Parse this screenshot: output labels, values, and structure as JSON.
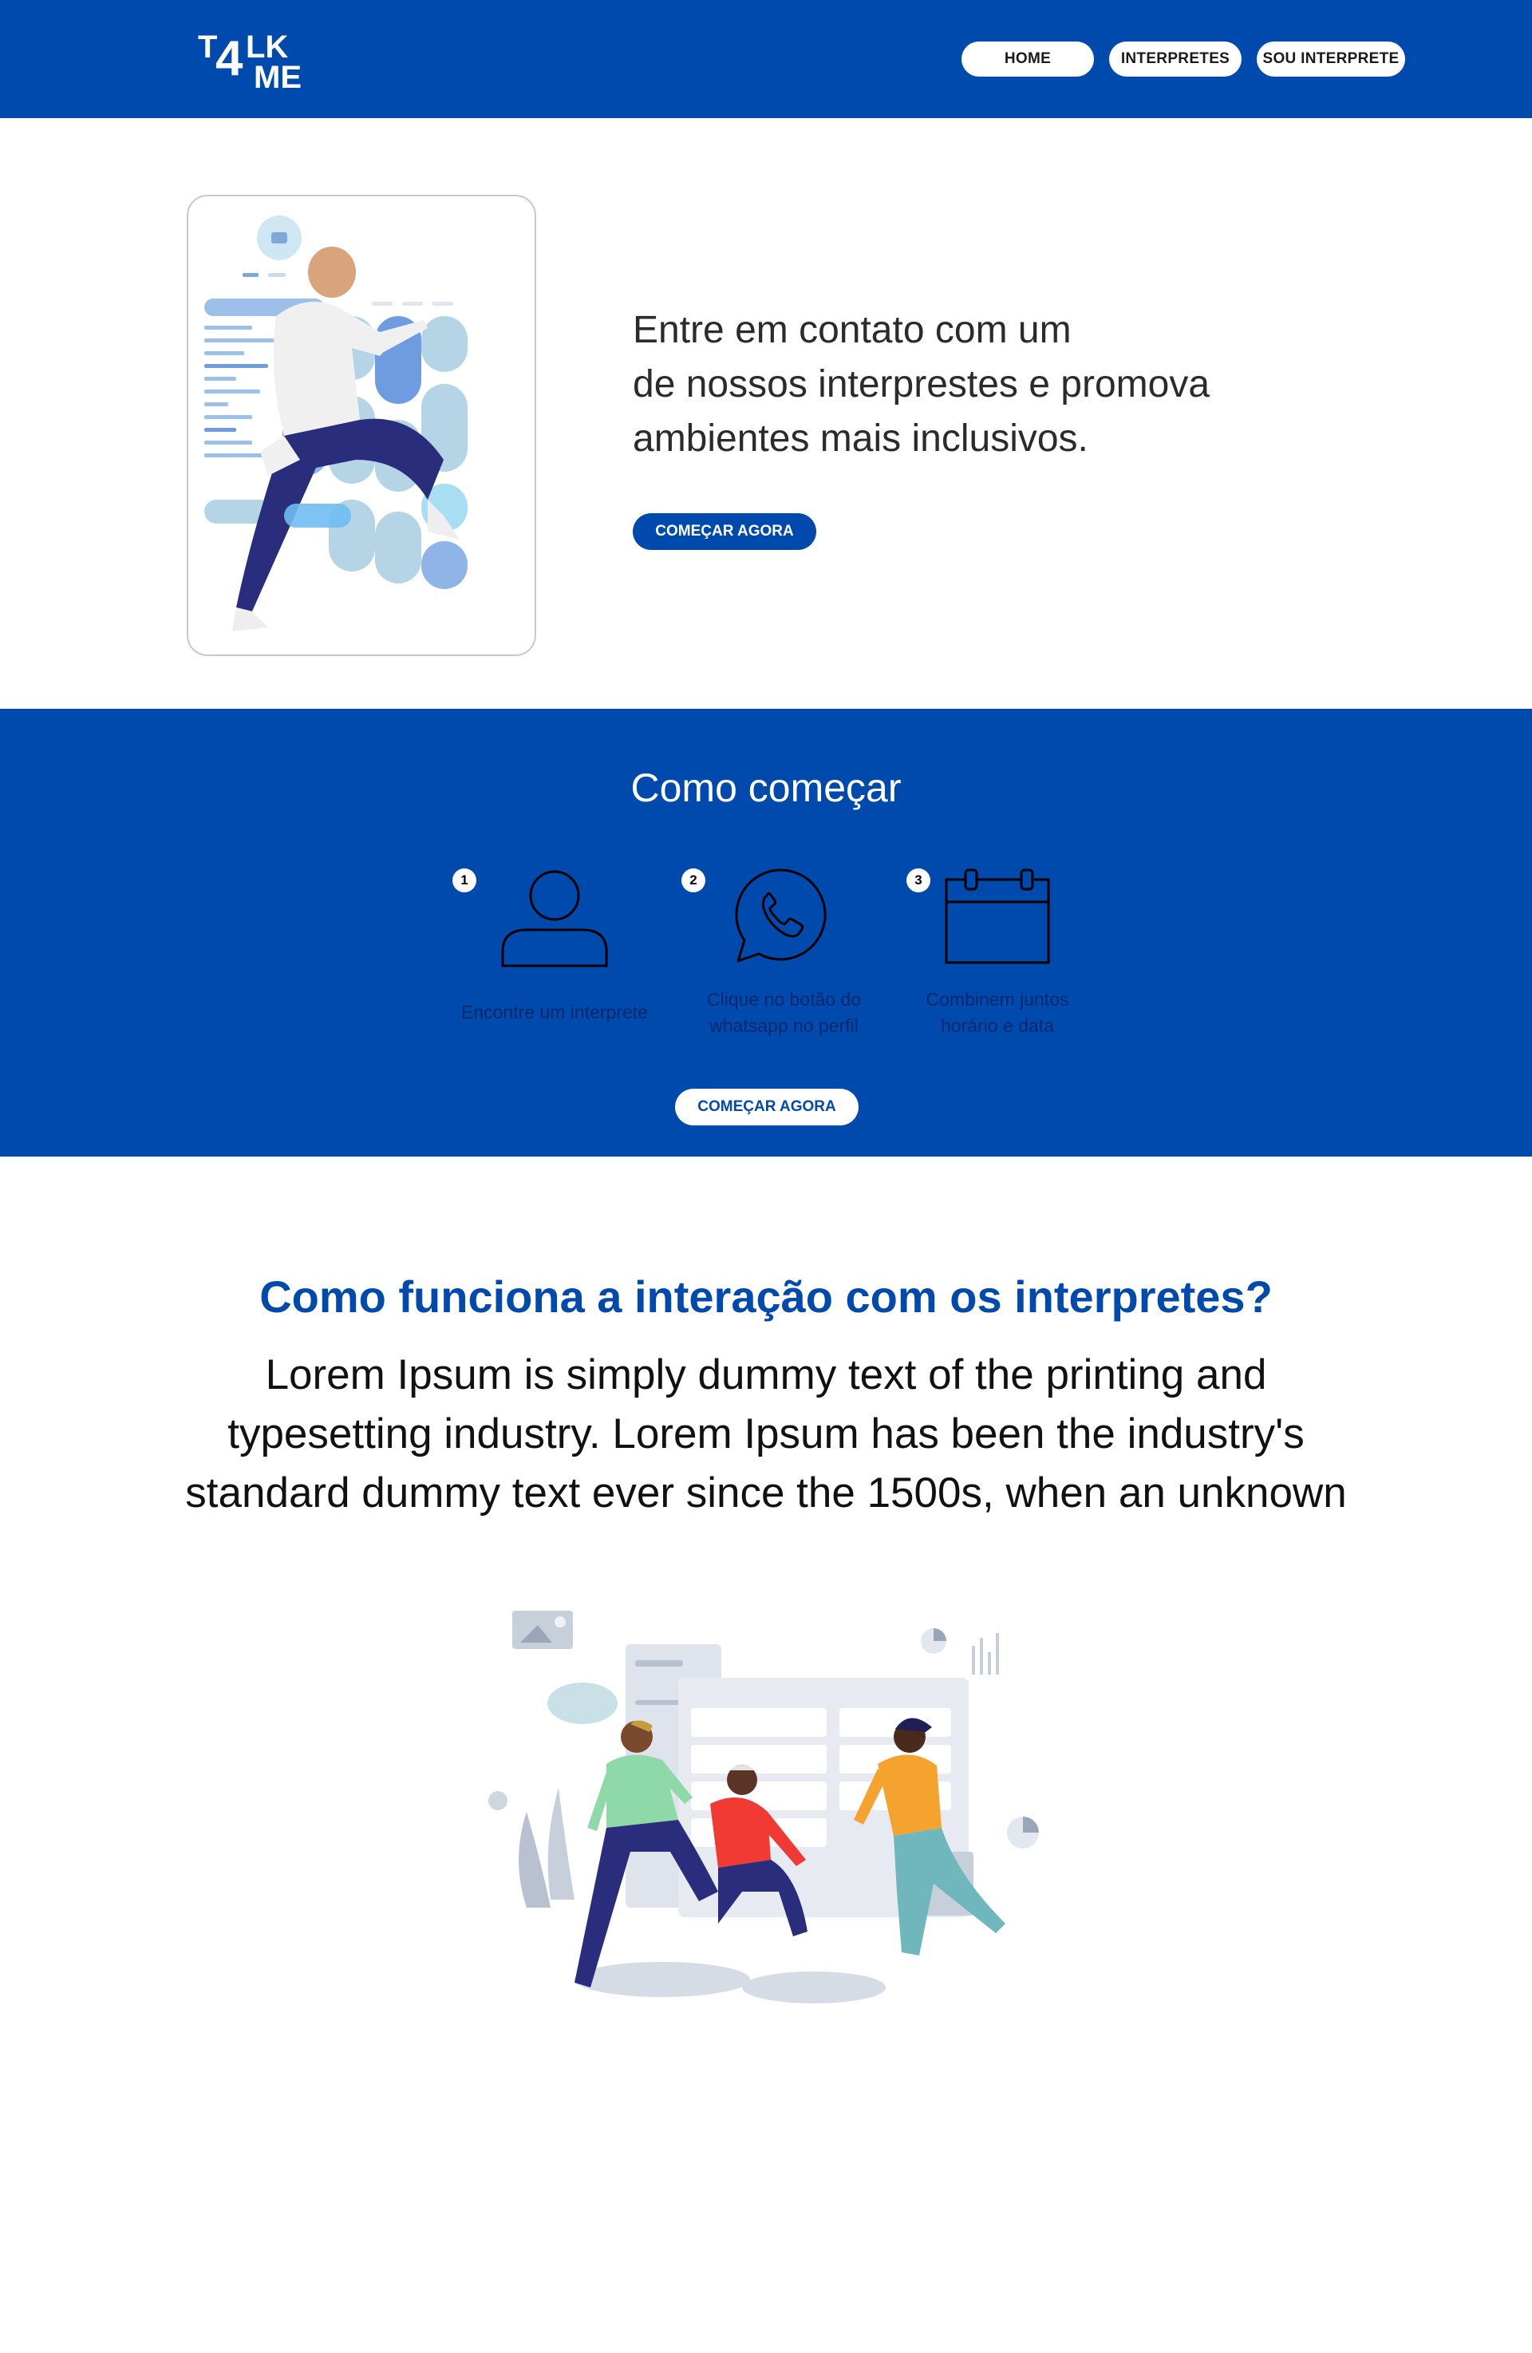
{
  "brand": {
    "logo_top": "T4LK",
    "logo_bottom": "ME"
  },
  "nav": {
    "home": "HOME",
    "interpretes": "INTERPRETES",
    "sou_interprete": "SOU INTERPRETE"
  },
  "hero": {
    "lines": [
      "Entre em contato com um",
      "de nossos interprestes e promova",
      "ambientes mais inclusivos."
    ],
    "cta": "COMEÇAR AGORA"
  },
  "steps": {
    "title": "Como começar",
    "items": [
      {
        "num": "1",
        "icon": "user-icon",
        "label": "Encontre um interprete"
      },
      {
        "num": "2",
        "icon": "whatsapp-icon",
        "label_lines": [
          "Clique no botão do",
          "whatsapp no perfil"
        ]
      },
      {
        "num": "3",
        "icon": "calendar-icon",
        "label_lines": [
          "Combinem juntos",
          "horário e data"
        ]
      }
    ],
    "cta": "COMEÇAR AGORA"
  },
  "info": {
    "title": "Como funciona a interação com os interpretes?",
    "body_lines": [
      "Lorem Ipsum is simply dummy text of the printing and",
      "typesetting industry. Lorem Ipsum has been the industry's",
      "standard dummy text ever since the 1500s, when an unknown"
    ]
  },
  "colors": {
    "brand_blue": "#004aad",
    "white": "#ffffff",
    "text_dark": "#2b2b2b"
  }
}
